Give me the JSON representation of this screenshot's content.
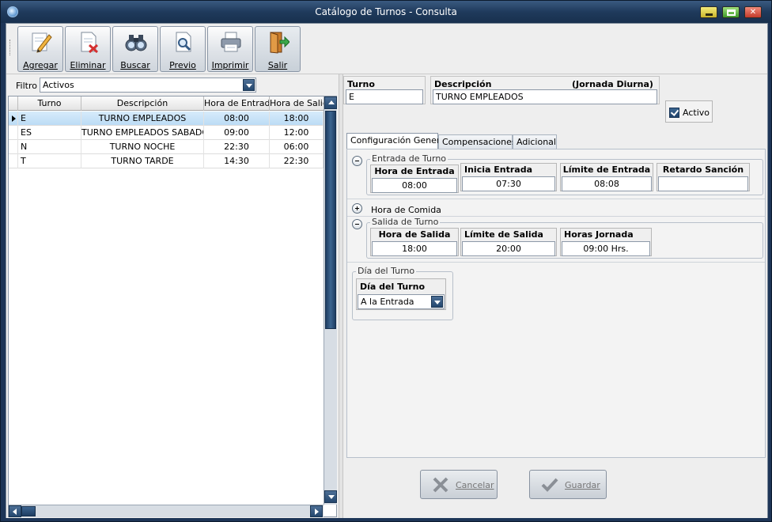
{
  "window": {
    "title": "Catálogo de Turnos - Consulta"
  },
  "toolbar": {
    "buttons": [
      {
        "label": "Agregar",
        "icon": "edit-pencil-icon"
      },
      {
        "label": "Eliminar",
        "icon": "delete-document-icon"
      },
      {
        "label": "Buscar",
        "icon": "binoculars-icon"
      },
      {
        "label": "Previo",
        "icon": "print-preview-icon"
      },
      {
        "label": "Imprimir",
        "icon": "printer-icon"
      },
      {
        "label": "Salir",
        "icon": "exit-door-icon"
      }
    ]
  },
  "filter": {
    "label": "Filtro",
    "value": "Activos"
  },
  "grid": {
    "columns": [
      "Turno",
      "Descripción",
      "Hora de Entrada",
      "Hora de Salida"
    ],
    "rows": [
      {
        "turno": "E",
        "descripcion": "TURNO EMPLEADOS",
        "entrada": "08:00",
        "salida": "18:00"
      },
      {
        "turno": "ES",
        "descripcion": "TURNO EMPLEADOS SABADO",
        "entrada": "09:00",
        "salida": "12:00"
      },
      {
        "turno": "N",
        "descripcion": "TURNO NOCHE",
        "entrada": "22:30",
        "salida": "06:00"
      },
      {
        "turno": "T",
        "descripcion": "TURNO TARDE",
        "entrada": "14:30",
        "salida": "22:30"
      }
    ],
    "selected_row": 0
  },
  "detail": {
    "turno_label": "Turno",
    "turno_value": "E",
    "descripcion_label": "Descripción",
    "jornada_label": "(Jornada Diurna)",
    "descripcion_value": "TURNO EMPLEADOS",
    "activo_label": "Activo",
    "activo_checked": true
  },
  "tabs": [
    {
      "label": "Configuración General",
      "active": true
    },
    {
      "label": "Compensaciones",
      "active": false
    },
    {
      "label": "Adicional",
      "active": false
    }
  ],
  "entrada": {
    "title": "Entrada de Turno",
    "hora_entrada_label": "Hora de Entrada",
    "hora_entrada": "08:00",
    "inicio_entrada_label": "Inicia Entrada",
    "inicio_entrada": "07:30",
    "limite_entrada_label": "Límite de Entrada",
    "limite_entrada": "08:08",
    "retardo_label": "Retardo Sanción",
    "retardo": ""
  },
  "comida": {
    "title": "Hora de Comida"
  },
  "salida": {
    "title": "Salida de Turno",
    "hora_salida_label": "Hora de Salida",
    "hora_salida": "18:00",
    "limite_salida_label": "Límite de Salida",
    "limite_salida": "20:00",
    "horas_jornada_label": "Horas Jornada",
    "horas_jornada": "09:00 Hrs."
  },
  "dia_turno": {
    "group_title": "Día del Turno",
    "label": "Día del Turno",
    "value": "A la Entrada"
  },
  "actions": {
    "cancel_label": "Cancelar",
    "save_label": "Guardar"
  },
  "colors": {
    "title_bar": "#1f3a5c",
    "selection": "#c8e2f8",
    "accent": "#24476e"
  }
}
